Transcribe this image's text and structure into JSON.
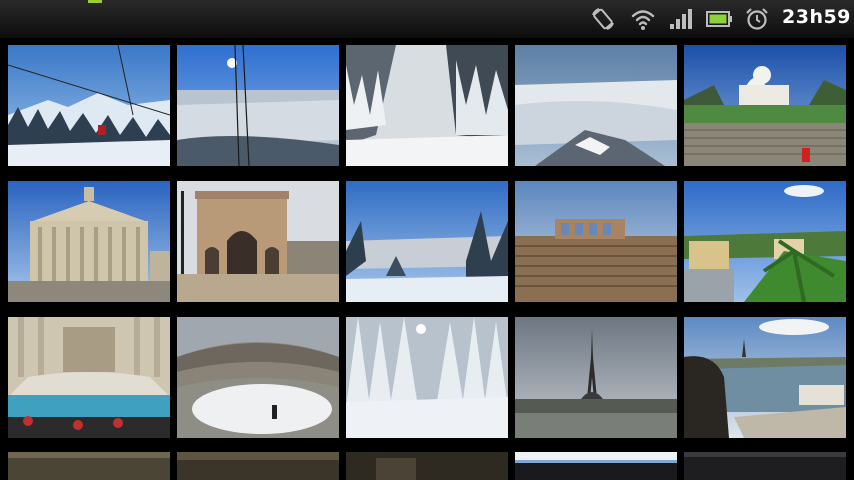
{
  "status_bar": {
    "time": "23h59",
    "icons": [
      "screen-rotation-icon",
      "wifi-icon",
      "signal-strength-icon",
      "battery-icon",
      "alarm-clock-icon"
    ]
  },
  "gallery": {
    "photos": [
      {
        "name": "photo-snowy-mountain-cable-car"
      },
      {
        "name": "photo-cable-car-view-valley"
      },
      {
        "name": "photo-snowy-forest-slope"
      },
      {
        "name": "photo-mountain-above-clouds"
      },
      {
        "name": "photo-sacre-coeur-basilica"
      },
      {
        "name": "photo-pantheon-paris"
      },
      {
        "name": "photo-arc-du-carrousel"
      },
      {
        "name": "photo-snowy-valley-view"
      },
      {
        "name": "photo-verona-arena"
      },
      {
        "name": "photo-hillside-villas-palm"
      },
      {
        "name": "photo-trevi-fountain"
      },
      {
        "name": "photo-snowy-arena-interior"
      },
      {
        "name": "photo-snow-covered-fir-forest"
      },
      {
        "name": "photo-eiffel-tower"
      },
      {
        "name": "photo-seine-river-eiffel"
      },
      {
        "name": "photo-partial-row-1"
      },
      {
        "name": "photo-partial-row-2"
      },
      {
        "name": "photo-partial-row-3"
      },
      {
        "name": "photo-partial-row-4"
      },
      {
        "name": "photo-partial-row-5"
      }
    ]
  }
}
